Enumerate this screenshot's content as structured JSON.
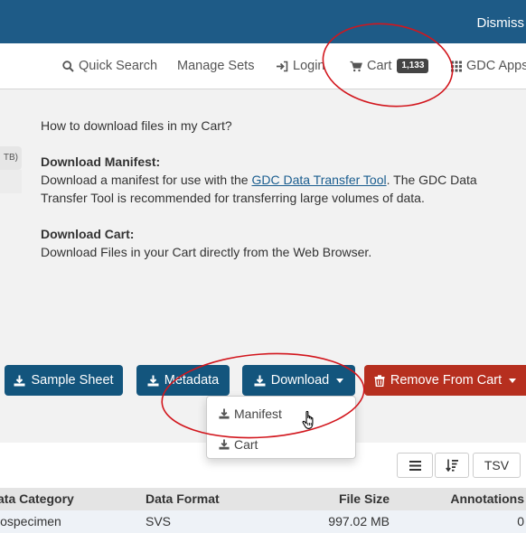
{
  "banner": {
    "dismiss_label": "Dismiss"
  },
  "nav": {
    "quick_search": "Quick Search",
    "manage_sets": "Manage Sets",
    "login": "Login",
    "cart": "Cart",
    "cart_count": "1,133",
    "apps": "GDC Apps"
  },
  "side": {
    "tag": "TB)"
  },
  "help": {
    "question": "How to download files in my Cart?",
    "manifest_title": "Download Manifest:",
    "manifest_text_pre": "Download a manifest for use with the ",
    "manifest_link": "GDC Data Transfer Tool",
    "manifest_text_post": ". The GDC Data Transfer Tool is recommended for transferring large volumes of data.",
    "cart_title": "Download Cart:",
    "cart_text": "Download Files in your Cart directly from the Web Browser."
  },
  "actions": {
    "sample_sheet": "Sample Sheet",
    "metadata": "Metadata",
    "download": "Download",
    "remove": "Remove From Cart"
  },
  "download_menu": {
    "manifest": "Manifest",
    "cart": "Cart"
  },
  "toolbar": {
    "tsv": "TSV"
  },
  "table": {
    "headers": [
      "ata Category",
      "Data Format",
      "File Size",
      "Annotations"
    ],
    "rows": [
      {
        "category": "iospecimen",
        "format": "SVS",
        "size": "997.02 MB",
        "annotations": "0"
      }
    ]
  },
  "colors": {
    "banner": "#1e5b87",
    "primary_button": "#13557d",
    "danger_button": "#b62f1f",
    "annotation": "#d2161d"
  }
}
